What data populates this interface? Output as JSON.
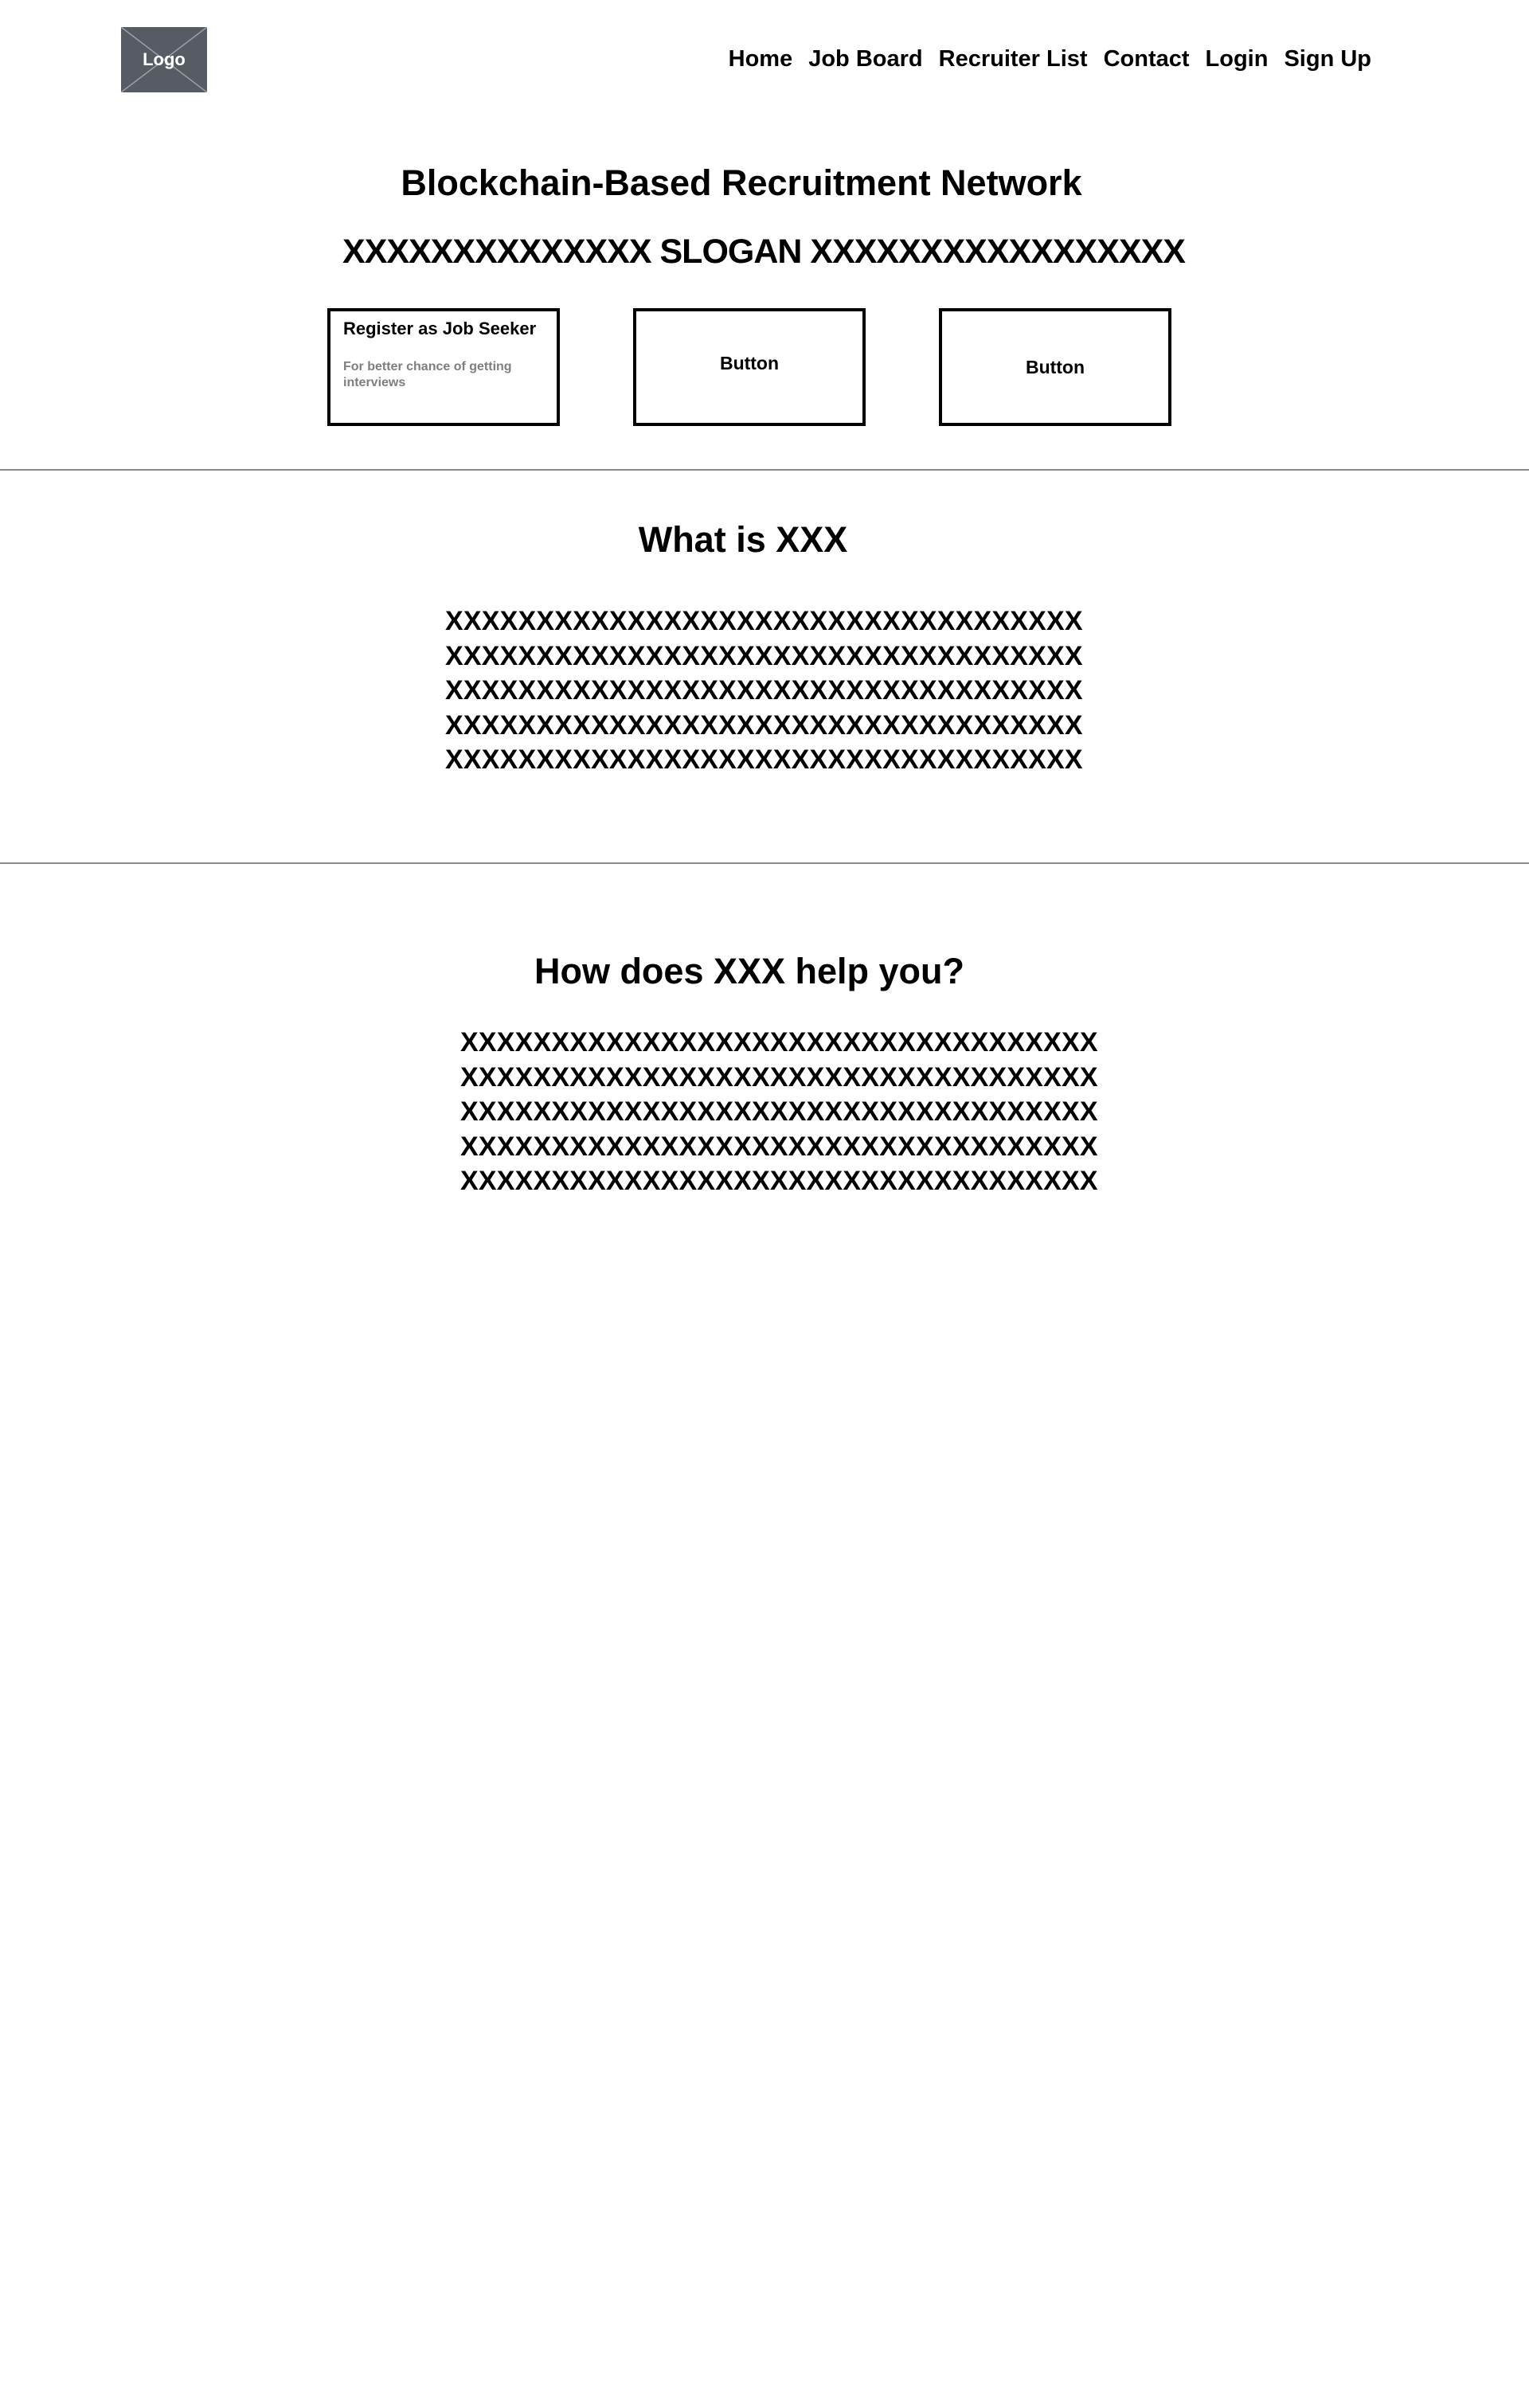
{
  "header": {
    "logo_label": "Logo",
    "nav": [
      "Home",
      "Job Board",
      "Recruiter List",
      "Contact",
      "Login",
      "Sign Up"
    ]
  },
  "hero": {
    "title": "Blockchain-Based Recruitment Network",
    "slogan": "XXXXXXXXXXXXXX SLOGAN XXXXXXXXXXXXXXXXX",
    "buttons": [
      {
        "title": "Register as Job Seeker",
        "subtitle": "For better chance of getting interviews"
      },
      {
        "label": "Button"
      },
      {
        "label": "Button"
      }
    ]
  },
  "what_is": {
    "heading": "What is XXX",
    "lines": [
      "XXXXXXXXXXXXXXXXXXXXXXXXXXXXXXXXXXX",
      "XXXXXXXXXXXXXXXXXXXXXXXXXXXXXXXXXXX",
      "XXXXXXXXXXXXXXXXXXXXXXXXXXXXXXXXXXX",
      "XXXXXXXXXXXXXXXXXXXXXXXXXXXXXXXXXXX",
      "XXXXXXXXXXXXXXXXXXXXXXXXXXXXXXXXXXX"
    ]
  },
  "how_help": {
    "heading": "How does XXX help you?",
    "lines": [
      "XXXXXXXXXXXXXXXXXXXXXXXXXXXXXXXXXXX",
      "XXXXXXXXXXXXXXXXXXXXXXXXXXXXXXXXXXX",
      "XXXXXXXXXXXXXXXXXXXXXXXXXXXXXXXXXXX",
      "XXXXXXXXXXXXXXXXXXXXXXXXXXXXXXXXXXX",
      "XXXXXXXXXXXXXXXXXXXXXXXXXXXXXXXXXXX"
    ]
  },
  "colors": {
    "logo_bg": "#565b64",
    "divider": "#8a8a8a",
    "subtitle_text": "#7e7e7e"
  }
}
